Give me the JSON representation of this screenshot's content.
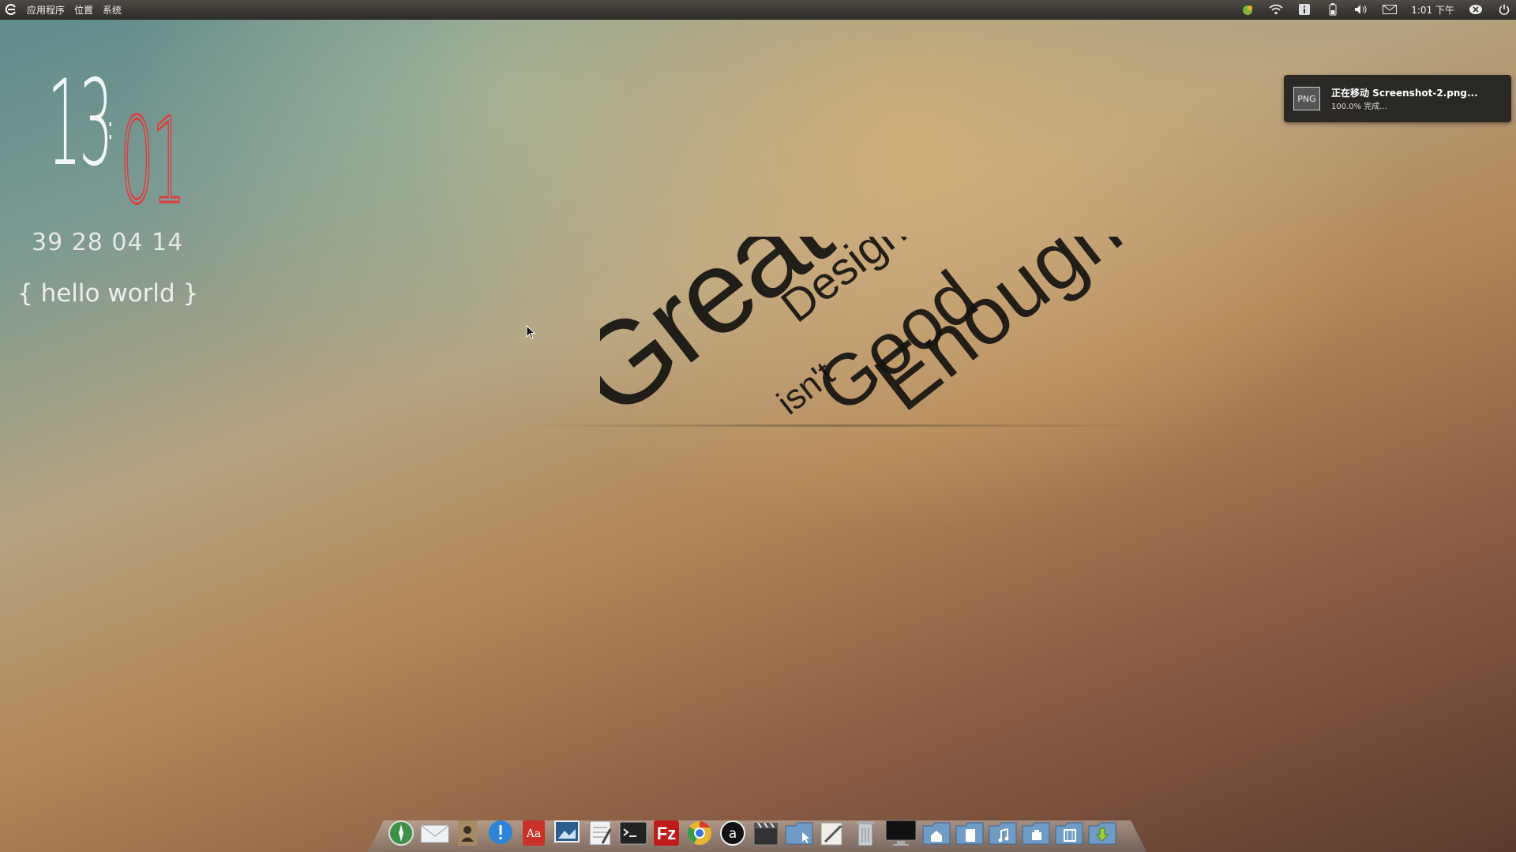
{
  "topbar": {
    "menu": [
      "应用程序",
      "位置",
      "系统"
    ],
    "clock": "1:01 下午"
  },
  "notification": {
    "thumb": "PNG",
    "title": "正在移动 Screenshot-2.png...",
    "body": "100.0% 完成..."
  },
  "clock_widget": {
    "hours": "13",
    "minutes": "01",
    "row": "39 28 04  14",
    "greeting": "{ hello world }"
  },
  "wallpaper": {
    "words": [
      "Great",
      "Design",
      "isn't",
      "Good",
      "Enough"
    ]
  },
  "dock": {
    "icons": [
      "safari-icon",
      "mail-icon",
      "contacts-icon",
      "messages-icon",
      "dictionary-icon",
      "preview-icon",
      "text-editor-icon",
      "terminal-icon",
      "filezilla-icon",
      "chrome-icon",
      "amazon-icon",
      "video-icon",
      "folder-icon",
      "notes-icon",
      "trash-icon",
      "monitor-icon",
      "home-folder-icon",
      "documents-folder-icon",
      "music-folder-icon",
      "apps-folder-icon",
      "movies-folder-icon",
      "downloads-folder-icon"
    ]
  },
  "colors": {
    "accent_red": "#e03c3c",
    "panel": "#3a3734"
  }
}
